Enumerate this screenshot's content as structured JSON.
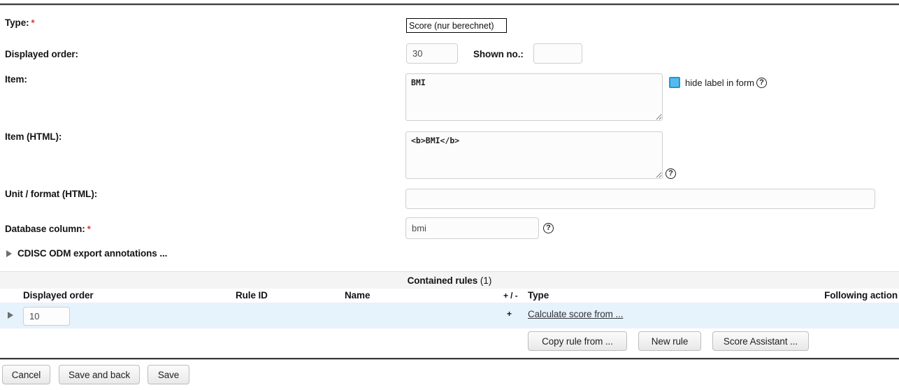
{
  "form": {
    "type": {
      "label": "Type:",
      "required": true,
      "value": "Score (nur berechnet)",
      "options": [
        "Score (nur berechnet)"
      ]
    },
    "displayed_order": {
      "label": "Displayed order:",
      "value": "30"
    },
    "shown_no": {
      "label": "Shown no.:",
      "value": ""
    },
    "item": {
      "label": "Item:",
      "value": "BMI",
      "hide_label_checkbox": {
        "label": "hide label in form",
        "checked": true
      },
      "help": "?"
    },
    "item_html": {
      "label": "Item (HTML):",
      "value": "<b>BMI</b>",
      "help": "?"
    },
    "unit_format_html": {
      "label": "Unit / format (HTML):",
      "value": "",
      "placeholder": ""
    },
    "database_column": {
      "label": "Database column:",
      "required": true,
      "value": "bmi",
      "help": "?"
    },
    "cdisc": {
      "label": "CDISC ODM export annotations ...",
      "expanded": false,
      "icon": "triangle-right-icon"
    }
  },
  "rules_table": {
    "band_title": "Contained rules",
    "band_count": "(1)",
    "columns": [
      "Displayed order",
      "Rule ID",
      "Name",
      "+ / -",
      "Type",
      "Following action"
    ],
    "rows": [
      {
        "expander": "triangle-right-icon",
        "displayed_order": "10",
        "rule_id": "",
        "name": "",
        "plus_minus": "+",
        "type": "Calculate score from ...",
        "following_action": ""
      }
    ]
  },
  "rule_actions": {
    "copy_rule": "Copy rule from ...",
    "new_rule": "New rule",
    "score_assistant": "Score Assistant ..."
  },
  "form_actions": {
    "cancel": "Cancel",
    "save_and_back": "Save and back",
    "save": "Save"
  },
  "colors": {
    "required_asterisk": "#e03030",
    "checkbox_accent": "#55bbee",
    "row_highlight": "#e6f2fc",
    "band_background": "#f4f4f4",
    "link": "#33333a"
  }
}
